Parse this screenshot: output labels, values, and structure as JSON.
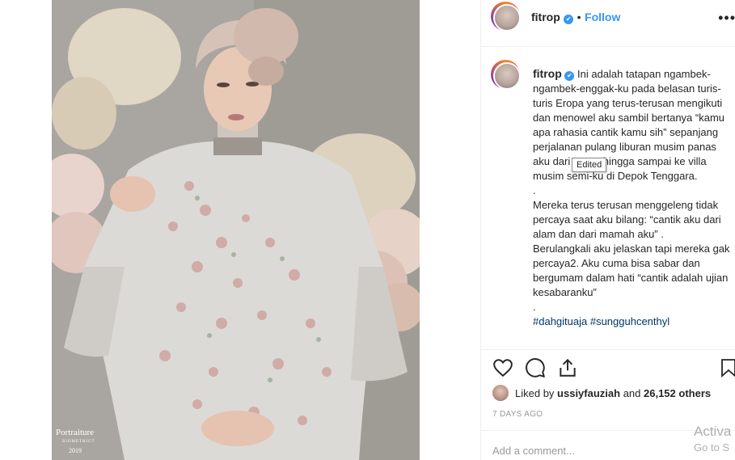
{
  "post": {
    "username": "fitrop",
    "verified_mark": "✔",
    "separator": "•",
    "follow_label": "Follow",
    "more_label": "•••",
    "caption_username": "fitrop",
    "caption_text": "Ini adalah tatapan ngambek-ngambek-enggak-ku pada belasan turis-turis Eropa yang terus-terusan mengikuti dan menowel aku sambil bertanya “kamu apa rahasia cantik kamu sih” sepanjang perjalanan pulang liburan musim panas aku dari eropa hingga sampai ke villa musim semi-ku di Depok Tenggara.\n.\nMereka terus terusan menggeleng tidak percaya saat aku bilang: “cantik aku dari alam dan dari mamah aku” .\nBerulangkali aku jelaskan tapi mereka gak percaya2. Aku cuma bisa sabar dan bergumam dalam hati “cantik adalah ujian kesabaranku”\n.",
    "hashtags": "#dahgituaja #sungguhcenthyl",
    "tooltip": "Edited",
    "liked_by_prefix": "Liked by ",
    "liked_by_user": "ussiyfauziah",
    "liked_by_and": " and ",
    "liked_by_others": "26,152 others",
    "timestamp": "7 DAYS AGO",
    "add_comment_placeholder": "Add a comment..."
  },
  "photo": {
    "watermark_brand": "Portraiture",
    "watermark_sub": "BIOMETRICT",
    "watermark_year": "2019"
  },
  "icons": {
    "like": "heart-icon",
    "comment": "comment-icon",
    "share": "share-icon",
    "save": "bookmark-icon",
    "verified": "verified-badge-icon",
    "more": "more-options-icon"
  },
  "os_overlay": {
    "line1": "Activa",
    "line2": "Go to S"
  },
  "colors": {
    "link_blue": "#3897f0",
    "hashtag": "#003569",
    "muted": "#999999",
    "text": "#262626"
  }
}
